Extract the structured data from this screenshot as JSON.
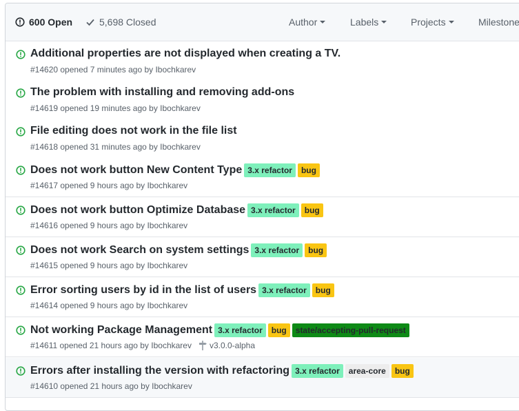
{
  "header": {
    "open_count": "600 Open",
    "closed_count": "5,698 Closed",
    "filters": [
      "Author",
      "Labels",
      "Projects",
      "Milestones"
    ]
  },
  "colors": {
    "open_icon": "#28a745",
    "refactor_label": "#7ef0bb",
    "bug_label": "#f9c513",
    "accepting_label": "#0e8a16",
    "area_core_label": "#ededed"
  },
  "issues": [
    {
      "title": "Additional properties are not displayed when creating a TV.",
      "meta": "#14620 opened 7 minutes ago by Ibochkarev",
      "labels": []
    },
    {
      "title": "The problem with installing and removing add-ons",
      "meta": "#14619 opened 19 minutes ago by Ibochkarev",
      "labels": []
    },
    {
      "title": "File editing does not work in the file list",
      "meta": "#14618 opened 31 minutes ago by Ibochkarev",
      "labels": []
    },
    {
      "title": "Does not work button New Content Type",
      "meta": "#14617 opened 9 hours ago by Ibochkarev",
      "labels": [
        "3.x refactor",
        "bug"
      ]
    },
    {
      "title": "Does not work button Optimize Database",
      "meta": "#14616 opened 9 hours ago by Ibochkarev",
      "labels": [
        "3.x refactor",
        "bug"
      ]
    },
    {
      "title": "Does not work Search on system settings",
      "meta": "#14615 opened 9 hours ago by Ibochkarev",
      "labels": [
        "3.x refactor",
        "bug"
      ]
    },
    {
      "title": "Error sorting users by id in the list of users",
      "meta": "#14614 opened 9 hours ago by Ibochkarev",
      "labels": [
        "3.x refactor",
        "bug"
      ]
    },
    {
      "title": "Not working Package Management",
      "meta": "#14611 opened 21 hours ago by Ibochkarev",
      "labels": [
        "3.x refactor",
        "bug",
        "state/accepting-pull-request"
      ],
      "milestone": "v3.0.0-alpha"
    },
    {
      "title": "Errors after installing the version with refactoring",
      "meta": "#14610 opened 21 hours ago by Ibochkarev",
      "labels": [
        "3.x refactor",
        "area-core",
        "bug"
      ]
    }
  ]
}
